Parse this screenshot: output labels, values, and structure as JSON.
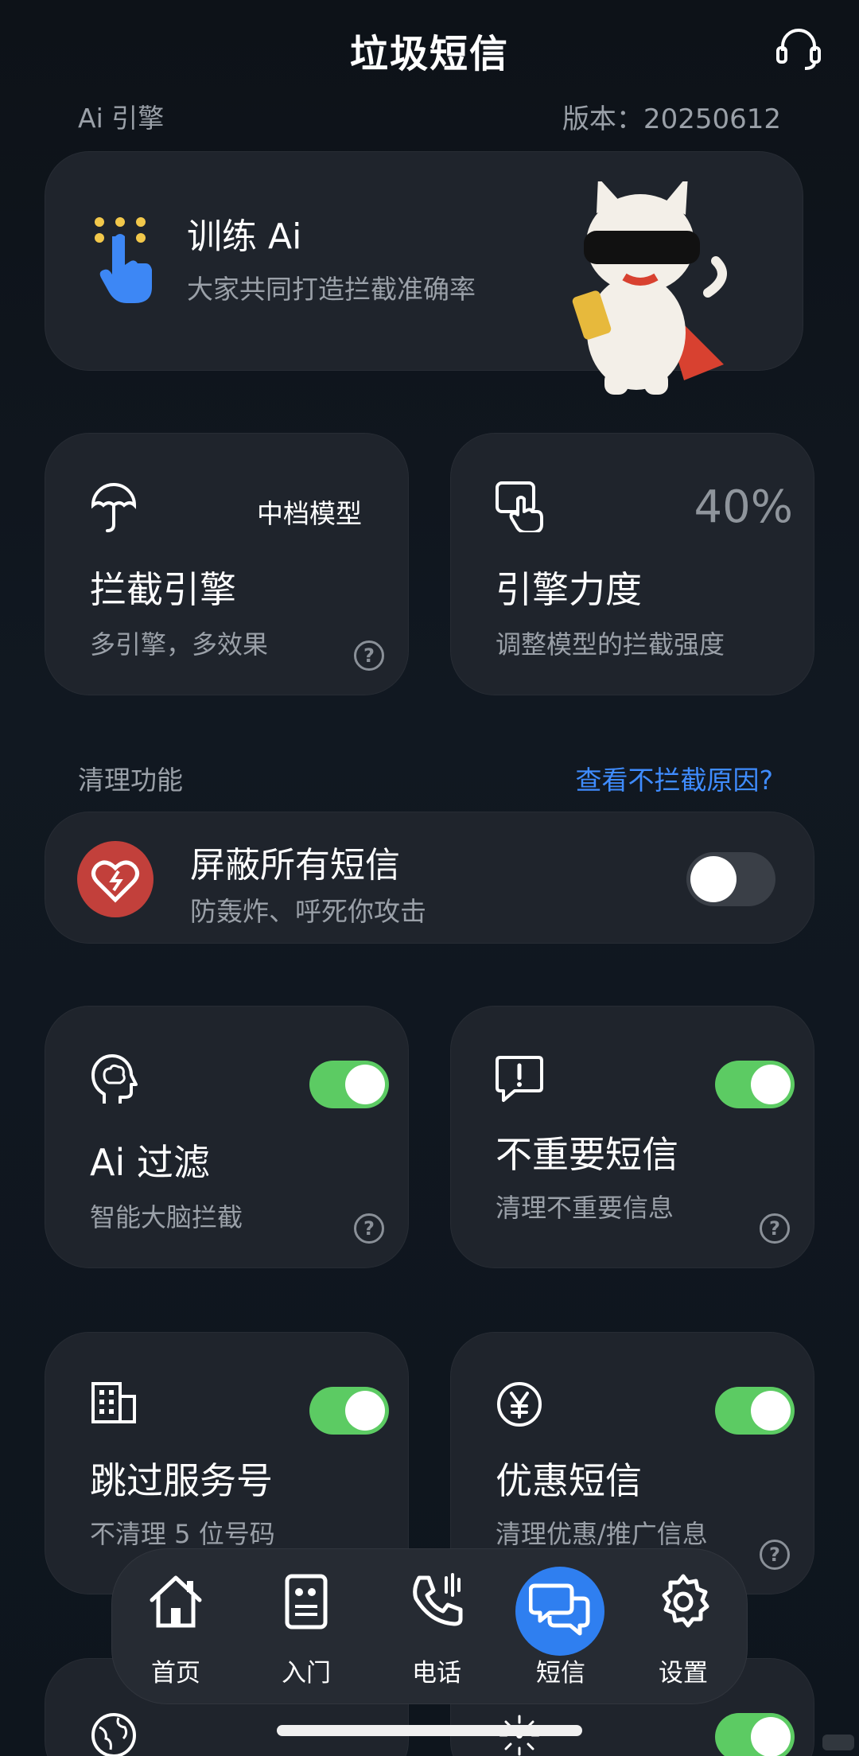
{
  "header": {
    "title": "垃圾短信"
  },
  "engine_section": {
    "label": "Ai 引擎",
    "version": "版本：20250612"
  },
  "train_card": {
    "title": "训练 Ai",
    "subtitle": "大家共同打造拦截准确率"
  },
  "intercept_engine": {
    "badge": "中档模型",
    "title": "拦截引擎",
    "subtitle": "多引擎，多效果",
    "help": "?"
  },
  "engine_strength": {
    "value": "40%",
    "title": "引擎力度",
    "subtitle": "调整模型的拦截强度"
  },
  "clean_section": {
    "label": "清理功能",
    "link": "查看不拦截原因?"
  },
  "block_all": {
    "title": "屏蔽所有短信",
    "subtitle": "防轰炸、呼死你攻击",
    "enabled": false
  },
  "ai_filter": {
    "title": "Ai 过滤",
    "subtitle": "智能大脑拦截",
    "enabled": true,
    "help": "?"
  },
  "unimportant_sms": {
    "title": "不重要短信",
    "subtitle": "清理不重要信息",
    "enabled": true,
    "help": "?"
  },
  "skip_service": {
    "title": "跳过服务号",
    "subtitle": "不清理 5 位号码",
    "enabled": true
  },
  "promo_sms": {
    "title": "优惠短信",
    "subtitle": "清理优惠/推广信息",
    "enabled": true,
    "help": "?"
  },
  "tabbar": {
    "items": [
      {
        "label": "首页",
        "icon": "home-icon"
      },
      {
        "label": "入门",
        "icon": "guide-icon"
      },
      {
        "label": "电话",
        "icon": "phone-icon"
      },
      {
        "label": "短信",
        "icon": "message-icon",
        "active": true
      },
      {
        "label": "设置",
        "icon": "gear-icon"
      }
    ]
  },
  "colors": {
    "accent": "#2f7ff0",
    "toggle_on": "#5ccb63",
    "danger": "#c2403b",
    "link": "#3f8cff"
  }
}
